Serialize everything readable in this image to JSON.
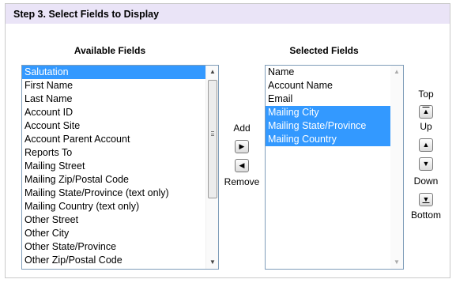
{
  "header": {
    "title": "Step 3. Select Fields to Display"
  },
  "available": {
    "title": "Available Fields",
    "items": [
      {
        "label": "Salutation",
        "selected": true
      },
      {
        "label": "First Name",
        "selected": false
      },
      {
        "label": "Last Name",
        "selected": false
      },
      {
        "label": "Account ID",
        "selected": false
      },
      {
        "label": "Account Site",
        "selected": false
      },
      {
        "label": "Account Parent Account",
        "selected": false
      },
      {
        "label": "Reports To",
        "selected": false
      },
      {
        "label": "Mailing Street",
        "selected": false
      },
      {
        "label": "Mailing Zip/Postal Code",
        "selected": false
      },
      {
        "label": "Mailing State/Province (text only)",
        "selected": false
      },
      {
        "label": "Mailing Country (text only)",
        "selected": false
      },
      {
        "label": "Other Street",
        "selected": false
      },
      {
        "label": "Other City",
        "selected": false
      },
      {
        "label": "Other State/Province",
        "selected": false
      },
      {
        "label": "Other Zip/Postal Code",
        "selected": false
      }
    ]
  },
  "selected": {
    "title": "Selected Fields",
    "items": [
      {
        "label": "Name",
        "selected": false
      },
      {
        "label": "Account Name",
        "selected": false
      },
      {
        "label": "Email",
        "selected": false
      },
      {
        "label": "Mailing City",
        "selected": true
      },
      {
        "label": "Mailing State/Province",
        "selected": true
      },
      {
        "label": "Mailing Country",
        "selected": true
      }
    ]
  },
  "transfer": {
    "add_label": "Add",
    "remove_label": "Remove"
  },
  "order": {
    "top_label": "Top",
    "up_label": "Up",
    "down_label": "Down",
    "bottom_label": "Bottom"
  },
  "icons": {
    "add": "arrow-right-icon",
    "remove": "arrow-left-icon",
    "top": "move-top-icon",
    "up": "arrow-up-icon",
    "down": "arrow-down-icon",
    "bottom": "move-bottom-icon"
  },
  "colors": {
    "header_bg": "#eae4f7",
    "selection": "#3399ff",
    "list_border": "#7f9db9"
  }
}
